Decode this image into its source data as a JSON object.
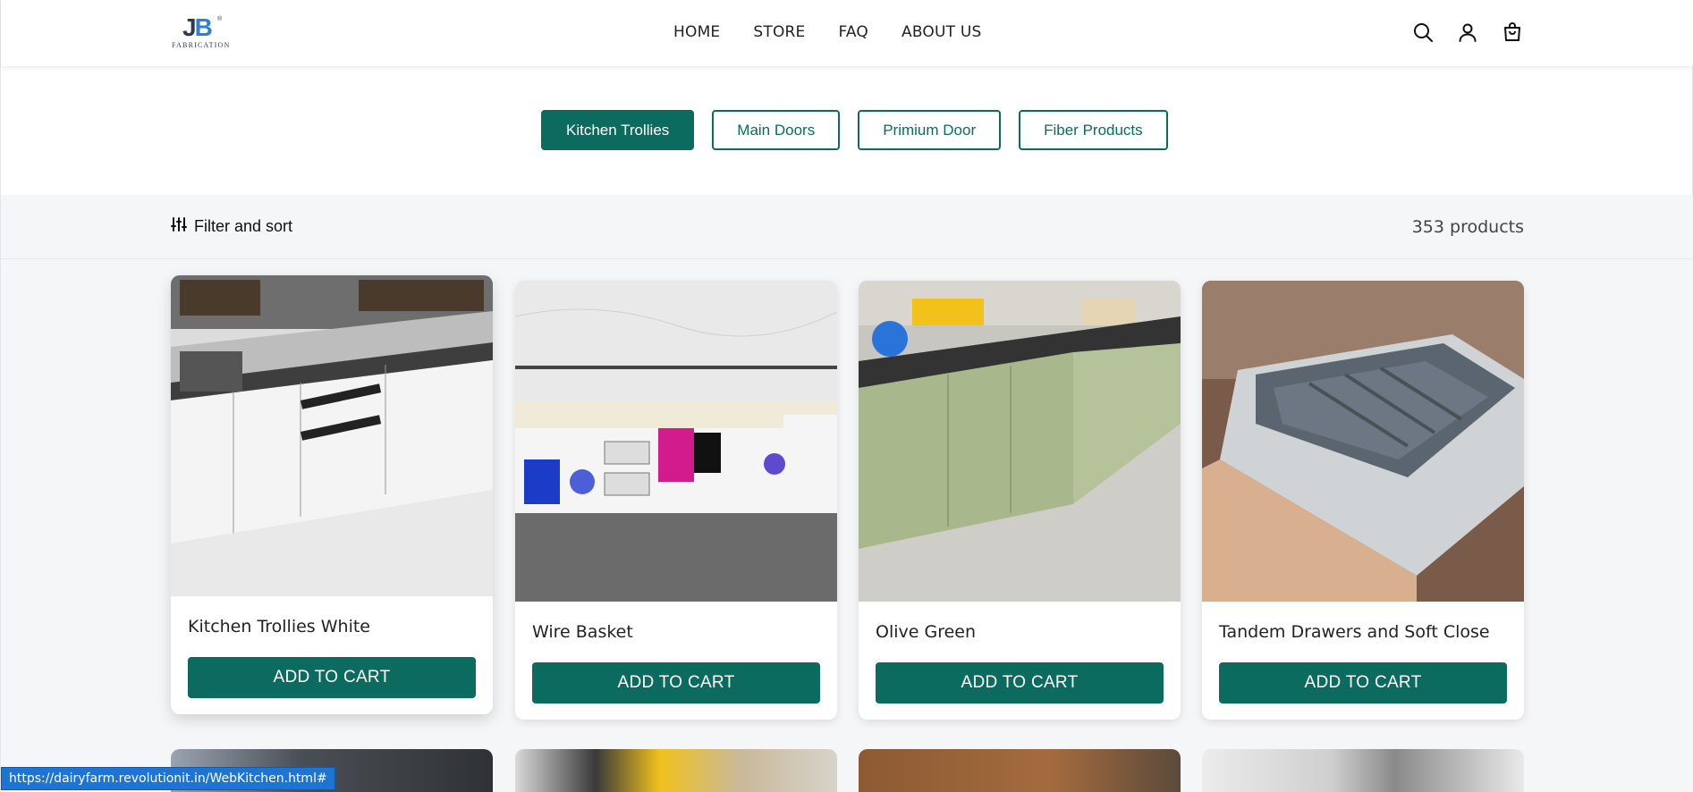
{
  "header": {
    "logo": {
      "mark_j": "J",
      "mark_b": "B",
      "registered": "®",
      "subtitle": "FABRICATION"
    },
    "nav": [
      "HOME",
      "STORE",
      "FAQ",
      "ABOUT US"
    ],
    "icons": [
      "search-icon",
      "account-icon",
      "cart-icon"
    ]
  },
  "categories": [
    {
      "label": "Kitchen Trollies",
      "active": true
    },
    {
      "label": "Main Doors",
      "active": false
    },
    {
      "label": "Primium Door",
      "active": false
    },
    {
      "label": "Fiber Products",
      "active": false
    }
  ],
  "toolbar": {
    "filter_label": "Filter and sort",
    "filter_icon": "sliders-icon",
    "product_count": "353 products"
  },
  "products": [
    {
      "name": "Kitchen Trollies White",
      "button": "ADD TO CART"
    },
    {
      "name": "Wire Basket",
      "button": "ADD TO CART"
    },
    {
      "name": "Olive Green",
      "button": "ADD TO CART"
    },
    {
      "name": "Tandem Drawers and Soft Close",
      "button": "ADD TO CART"
    }
  ],
  "status_bar": {
    "url": "https://dairyfarm.revolutionit.in/WebKitchen.html#"
  },
  "colors": {
    "primary": "#0b6b5e",
    "background": "#f5f6f8",
    "status": "#1e74d3"
  }
}
